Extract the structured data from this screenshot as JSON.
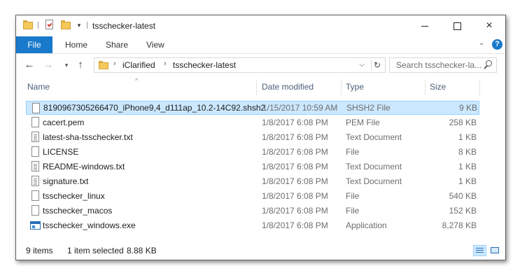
{
  "window": {
    "title": "tsschecker-latest"
  },
  "window_controls": {
    "minimize": "minimize",
    "maximize": "maximize",
    "close": "×"
  },
  "ribbon": {
    "tabs": [
      "File",
      "Home",
      "Share",
      "View"
    ]
  },
  "address": {
    "breadcrumbs": [
      "iClarified",
      "tsschecker-latest"
    ]
  },
  "search": {
    "placeholder": "Search tsschecker-la..."
  },
  "columns": {
    "name": "Name",
    "date": "Date modified",
    "type": "Type",
    "size": "Size"
  },
  "files": [
    {
      "name": "8190967305266470_iPhone9,4_d111ap_10.2-14C92.shsh2",
      "date": "1/15/2017 10:59 AM",
      "type": "SHSH2 File",
      "size": "9 KB",
      "icon": "file-icon",
      "selected": true
    },
    {
      "name": "cacert.pem",
      "date": "1/8/2017 6:08 PM",
      "type": "PEM File",
      "size": "258 KB",
      "icon": "file-icon",
      "selected": false
    },
    {
      "name": "latest-sha-tsschecker.txt",
      "date": "1/8/2017 6:08 PM",
      "type": "Text Document",
      "size": "1 KB",
      "icon": "text-file-icon",
      "selected": false
    },
    {
      "name": "LICENSE",
      "date": "1/8/2017 6:08 PM",
      "type": "File",
      "size": "8 KB",
      "icon": "file-icon",
      "selected": false
    },
    {
      "name": "README-windows.txt",
      "date": "1/8/2017 6:08 PM",
      "type": "Text Document",
      "size": "1 KB",
      "icon": "text-file-icon",
      "selected": false
    },
    {
      "name": "signature.txt",
      "date": "1/8/2017 6:08 PM",
      "type": "Text Document",
      "size": "1 KB",
      "icon": "text-file-icon",
      "selected": false
    },
    {
      "name": "tsschecker_linux",
      "date": "1/8/2017 6:08 PM",
      "type": "File",
      "size": "540 KB",
      "icon": "file-icon",
      "selected": false
    },
    {
      "name": "tsschecker_macos",
      "date": "1/8/2017 6:08 PM",
      "type": "File",
      "size": "152 KB",
      "icon": "file-icon",
      "selected": false
    },
    {
      "name": "tsschecker_windows.exe",
      "date": "1/8/2017 6:08 PM",
      "type": "Application",
      "size": "8,278 KB",
      "icon": "application-icon",
      "selected": false
    }
  ],
  "status": {
    "item_count": "9 items",
    "selection": "1 item selected",
    "selection_size": "8.88 KB"
  },
  "colors": {
    "accent": "#1979ca",
    "selection_bg": "#cce8ff",
    "selection_border": "#99d1ff",
    "header_text": "#4c607a"
  }
}
